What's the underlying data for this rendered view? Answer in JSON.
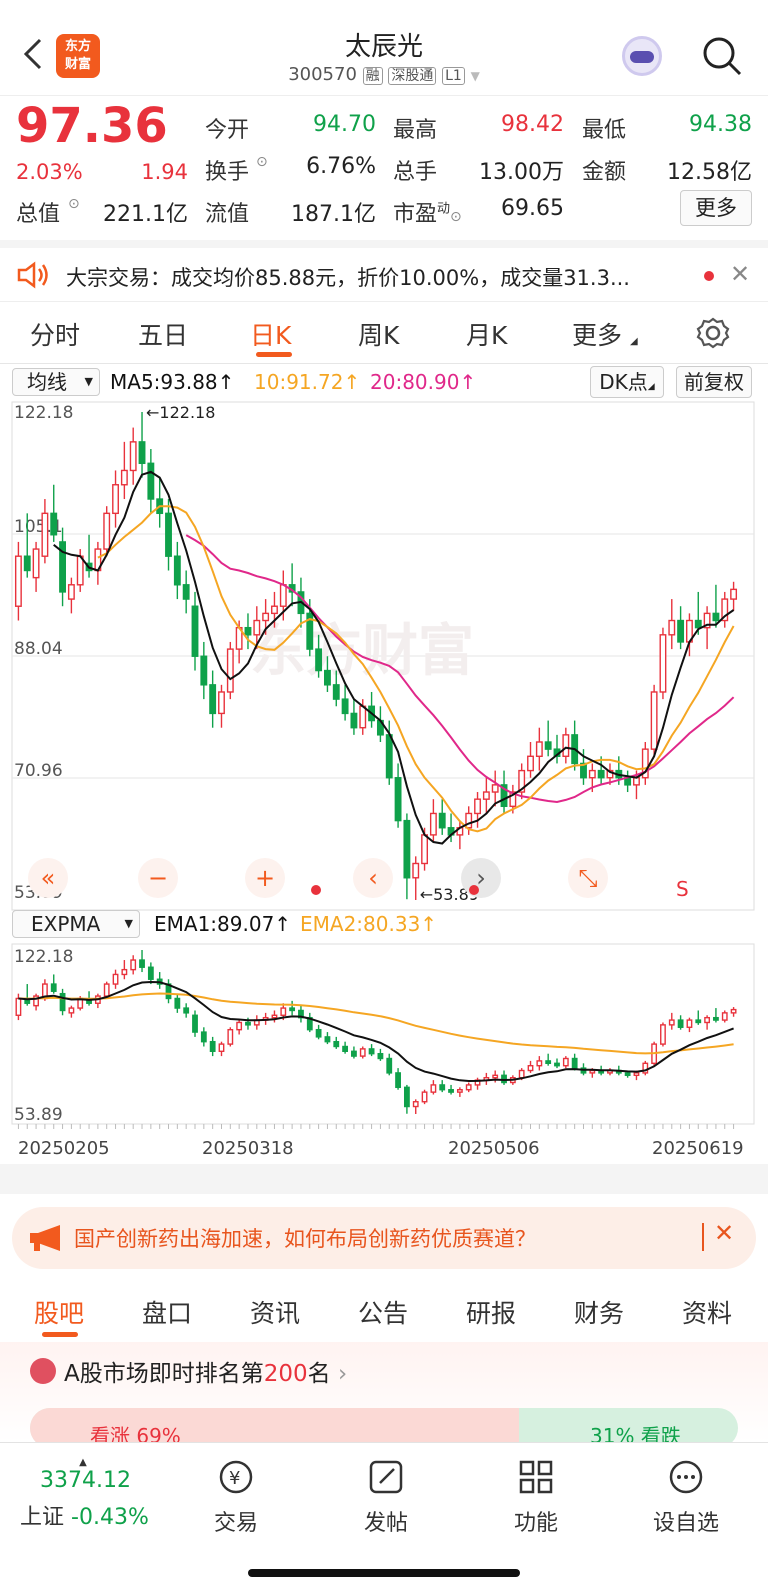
{
  "header": {
    "title": "太辰光",
    "code": "300570",
    "badges": [
      "融",
      "深股通",
      "L1"
    ],
    "logo_text": [
      "东方",
      "财富"
    ]
  },
  "quote": {
    "price": "97.36",
    "change_pct": "2.03%",
    "change_amt": "1.94",
    "open_label": "今开",
    "open": "94.70",
    "high_label": "最高",
    "high": "98.42",
    "low_label": "最低",
    "low": "94.38",
    "turnover_label": "换手",
    "turnover": "6.76%",
    "volume_label": "总手",
    "volume": "13.00万",
    "amount_label": "金额",
    "amount": "12.58亿",
    "mcap_label": "总值",
    "mcap": "221.1亿",
    "float_label": "流值",
    "float": "187.1亿",
    "pe_label": "市盈",
    "pe_sup": "动",
    "pe": "69.65",
    "more_label": "更多"
  },
  "notice": {
    "text": "大宗交易：成交均价85.88元，折价10.00%，成交量31.3..."
  },
  "ktabs": [
    "分时",
    "五日",
    "日K",
    "周K",
    "月K",
    "更多"
  ],
  "ma_bar": {
    "select": "均线",
    "ma5": "MA5:93.88↑",
    "ma10": "10:91.72↑",
    "ma20": "20:80.90↑",
    "dk": "DK点",
    "fq": "前复权"
  },
  "exp_bar": {
    "select": "EXPMA",
    "ema1": "EMA1:89.07↑",
    "ema2": "EMA2:80.33↑"
  },
  "chart_data": {
    "type": "candlestick",
    "y_labels": [
      "122.18",
      "105.1",
      "88.04",
      "70.96",
      "53.89"
    ],
    "ylim": [
      53.89,
      122.18
    ],
    "max_label": "←122.18",
    "min_label": "←53.89",
    "sub_y_labels": [
      "122.18",
      "53.89"
    ],
    "x_labels": [
      "20250205",
      "20250318",
      "20250506",
      "20250619"
    ],
    "watermark": "东方财富",
    "ohlc": [
      [
        95,
        104,
        93,
        102
      ],
      [
        102,
        108,
        99,
        100
      ],
      [
        99,
        104,
        97,
        103
      ],
      [
        102,
        110,
        101,
        108
      ],
      [
        108,
        112,
        104,
        105
      ],
      [
        104,
        106,
        95,
        97
      ],
      [
        96,
        99,
        94,
        98
      ],
      [
        98,
        103,
        97,
        102
      ],
      [
        101,
        105,
        99,
        100
      ],
      [
        100,
        104,
        98,
        103
      ],
      [
        103,
        109,
        102,
        108
      ],
      [
        108,
        114,
        106,
        112
      ],
      [
        112,
        118,
        110,
        114
      ],
      [
        114,
        120,
        112,
        118
      ],
      [
        118,
        122.18,
        113,
        115
      ],
      [
        115,
        117,
        108,
        110
      ],
      [
        110,
        113,
        106,
        108
      ],
      [
        108,
        110,
        100,
        102
      ],
      [
        102,
        104,
        96,
        98
      ],
      [
        98,
        100,
        94,
        96
      ],
      [
        95,
        97,
        86,
        88
      ],
      [
        88,
        90,
        82,
        84
      ],
      [
        84,
        86,
        78,
        80
      ],
      [
        80,
        84,
        78,
        83
      ],
      [
        83,
        90,
        82,
        89
      ],
      [
        89,
        93,
        87,
        92
      ],
      [
        92,
        94,
        89,
        91
      ],
      [
        91,
        95,
        89,
        93
      ],
      [
        93,
        96,
        91,
        94
      ],
      [
        94,
        97,
        92,
        95
      ],
      [
        95,
        100,
        93,
        98
      ],
      [
        98,
        101,
        95,
        97
      ],
      [
        97,
        99,
        92,
        94
      ],
      [
        94,
        96,
        88,
        89
      ],
      [
        89,
        91,
        85,
        86
      ],
      [
        86,
        88,
        83,
        84
      ],
      [
        84,
        86,
        81,
        82
      ],
      [
        82,
        84,
        79,
        80
      ],
      [
        80,
        82,
        77,
        78
      ],
      [
        78,
        82,
        77,
        81
      ],
      [
        81,
        83,
        78,
        79
      ],
      [
        79,
        81,
        76,
        77
      ],
      [
        77,
        79,
        70,
        71
      ],
      [
        71,
        73,
        64,
        65
      ],
      [
        65,
        66,
        54,
        57
      ],
      [
        57,
        60,
        53.89,
        59
      ],
      [
        59,
        64,
        58,
        63
      ],
      [
        63,
        68,
        62,
        66
      ],
      [
        66,
        68,
        63,
        64
      ],
      [
        64,
        66,
        62,
        63
      ],
      [
        63,
        65,
        61,
        64
      ],
      [
        64,
        67,
        63,
        66
      ],
      [
        66,
        69,
        64,
        68
      ],
      [
        68,
        71,
        66,
        69
      ],
      [
        69,
        72,
        67,
        70
      ],
      [
        70,
        72,
        66,
        67
      ],
      [
        67,
        70,
        66,
        69
      ],
      [
        69,
        73,
        68,
        72
      ],
      [
        72,
        76,
        71,
        74
      ],
      [
        74,
        78,
        72,
        76
      ],
      [
        76,
        79,
        74,
        75
      ],
      [
        75,
        77,
        73,
        74
      ],
      [
        74,
        78,
        73,
        77
      ],
      [
        77,
        79,
        72,
        73
      ],
      [
        73,
        75,
        70,
        71
      ],
      [
        71,
        73,
        69,
        72
      ],
      [
        72,
        74,
        70,
        71
      ],
      [
        71,
        73,
        70,
        72
      ],
      [
        72,
        74,
        70,
        71
      ],
      [
        71,
        72,
        69,
        70
      ],
      [
        70,
        72,
        68,
        71
      ],
      [
        71,
        76,
        70,
        75
      ],
      [
        75,
        84,
        74,
        83
      ],
      [
        83,
        92,
        82,
        91
      ],
      [
        91,
        96,
        89,
        93
      ],
      [
        93,
        95,
        89,
        90
      ],
      [
        90,
        94,
        88,
        93
      ],
      [
        93,
        97,
        91,
        92
      ],
      [
        92,
        95,
        89,
        94
      ],
      [
        94,
        98,
        92,
        93
      ],
      [
        93,
        97,
        92,
        96
      ],
      [
        96,
        98.42,
        94.38,
        97.36
      ]
    ]
  },
  "promo": {
    "text": "国产创新药出海加速，如何布局创新药优质赛道？"
  },
  "tabs2": [
    "股吧",
    "盘口",
    "资讯",
    "公告",
    "研报",
    "财务",
    "资料"
  ],
  "rank": {
    "prefix": "A股市场即时排名第",
    "num": "200",
    "suffix": "名",
    "up": "看涨 69%",
    "down": "31% 看跌"
  },
  "bottom_nav": {
    "index_value": "3374.12",
    "index_name": "上证",
    "index_change": "-0.43%",
    "items": [
      "交易",
      "发帖",
      "功能",
      "设自选"
    ]
  },
  "colors": {
    "up": "#e8323c",
    "down": "#0fa14a",
    "ma5": "#111111",
    "ma10": "#f5a623",
    "ma20": "#e0288a",
    "accent": "#f25a1e"
  }
}
